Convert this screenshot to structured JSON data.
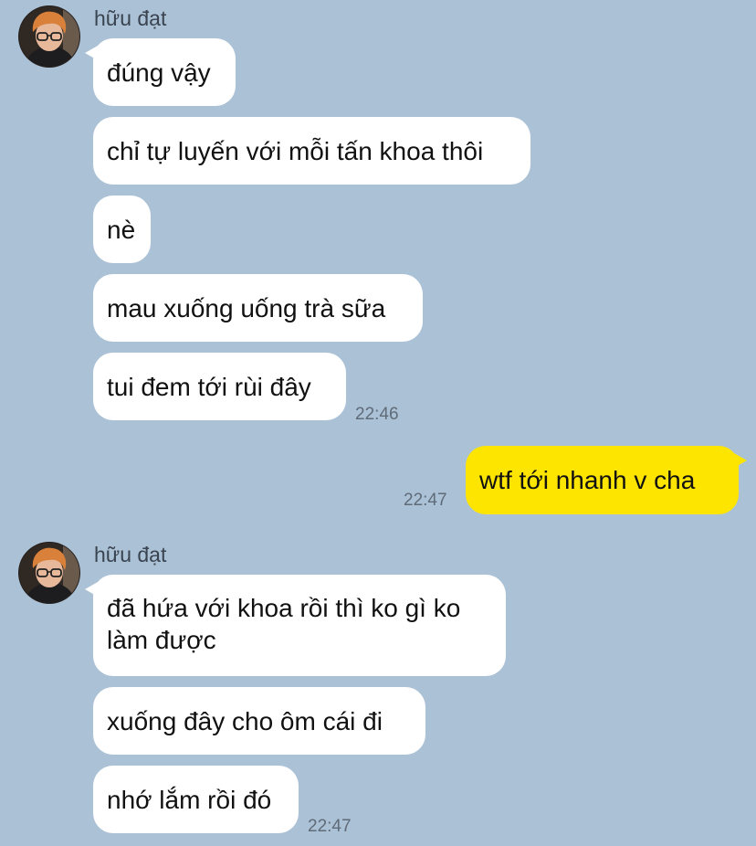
{
  "colors": {
    "background": "#abc1d6",
    "incoming_bubble": "#ffffff",
    "outgoing_bubble": "#fee500",
    "timestamp": "#5f6b78",
    "sender_name": "#3a4450"
  },
  "messages": {
    "group1": {
      "sender": "hữu đạt",
      "avatar_icon": "user-avatar-icon",
      "texts": [
        "đúng vậy",
        "chỉ tự luyến với mỗi tấn khoa thôi",
        "nè",
        "mau xuống uống trà sữa",
        "tui đem tới rùi đây"
      ],
      "time": "22:46"
    },
    "mine1": {
      "text": "wtf tới nhanh v cha",
      "time": "22:47"
    },
    "group2": {
      "sender": "hữu đạt",
      "avatar_icon": "user-avatar-icon",
      "texts": [
        "đã hứa với khoa rồi thì ko gì ko làm được",
        "xuống đây cho ôm cái đi",
        "nhớ lắm rồi đó"
      ],
      "time": "22:47"
    }
  }
}
